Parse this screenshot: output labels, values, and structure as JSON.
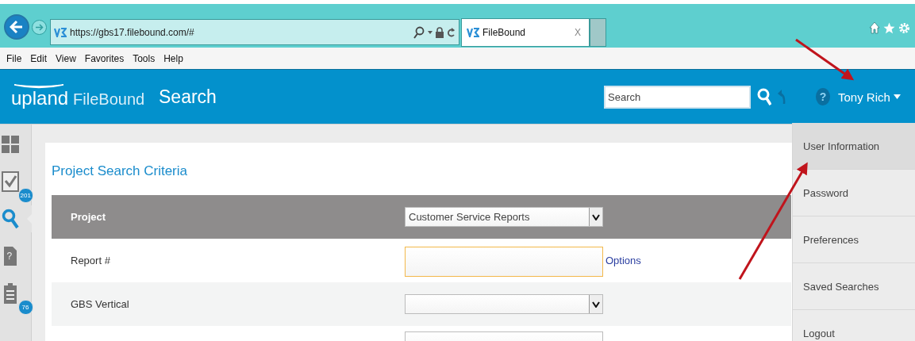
{
  "browser": {
    "address": "https://gbs17.filebound.com/#",
    "tab": {
      "title": "FileBound",
      "close": "X"
    },
    "menu": [
      "File",
      "Edit",
      "View",
      "Favorites",
      "Tools",
      "Help"
    ]
  },
  "header": {
    "logo": "upland",
    "product": "FileBound",
    "page_title": "Search",
    "search": {
      "placeholder": "Search"
    },
    "help": "?",
    "user": "Tony Rich"
  },
  "sidebar": {
    "items": [
      {
        "kind": "dashboard",
        "selected": false
      },
      {
        "kind": "tasks",
        "badge": "201",
        "selected": false
      },
      {
        "kind": "search",
        "selected": true
      },
      {
        "kind": "help-doc",
        "glyph": "?",
        "selected": false
      },
      {
        "kind": "clipboard",
        "badge": "76",
        "selected": false
      }
    ]
  },
  "criteria": {
    "title": "Project Search Criteria",
    "rows": [
      {
        "kind": "header",
        "label": "Project",
        "value": "Customer Service Reports"
      },
      {
        "kind": "text",
        "label": "Report #",
        "focused": true,
        "link": "Options"
      },
      {
        "kind": "select",
        "label": "GBS Vertical"
      },
      {
        "kind": "text"
      }
    ]
  },
  "user_menu": {
    "items": [
      {
        "label": "User Information",
        "selected": true
      },
      {
        "label": "Password",
        "selected": false
      },
      {
        "label": "Preferences",
        "selected": false
      },
      {
        "label": "Saved Searches",
        "selected": false
      },
      {
        "label": "Logout",
        "selected": false
      }
    ]
  }
}
